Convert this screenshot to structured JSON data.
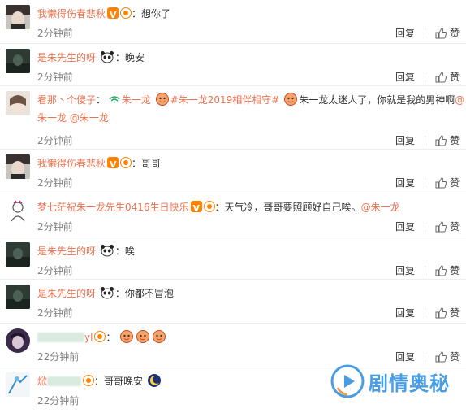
{
  "comments": [
    {
      "user": "我懒得伤春悲秋",
      "segments": [
        "：想你了"
      ],
      "time": "2分钟前"
    },
    {
      "user": "是朱先生的呀",
      "segments": [
        "：晚安"
      ],
      "time": "2分钟前"
    },
    {
      "user": "看那丶个傻子",
      "sep": "：",
      "link_label": "朱一龙",
      "topic": "#朱一龙2019相伴相守#",
      "text": "朱一龙太迷人了，你就是我的男神啊",
      "mention_end": "@",
      "line2_user": "朱一龙",
      "line2_mention": "@朱一龙",
      "time": "2分钟前"
    },
    {
      "user": "我懒得伤春悲秋",
      "segments": [
        "：哥哥"
      ],
      "time": "2分钟前"
    },
    {
      "user": "梦七茫祝朱一龙先生0416生日快乐",
      "text": "：天气冷，哥哥要照顾好自己唉。",
      "mention": "@朱一龙",
      "time": "2分钟前"
    },
    {
      "user": "是朱先生的呀",
      "segments": [
        "：唉"
      ],
      "time": "2分钟前"
    },
    {
      "user": "是朱先生的呀",
      "segments": [
        "：你都不冒泡"
      ],
      "time": "2分钟前"
    },
    {
      "user_tail": "yl",
      "sep": "：",
      "time": "22分钟前"
    },
    {
      "user_head": "焮",
      "text": "：哥哥晚安",
      "time": "22分钟前"
    }
  ],
  "actions": {
    "reply": "回复",
    "like": "赞"
  },
  "watermark": "剧情奥秘",
  "colors": {
    "username": "#eb7350",
    "time": "#808080",
    "text": "#333333"
  }
}
